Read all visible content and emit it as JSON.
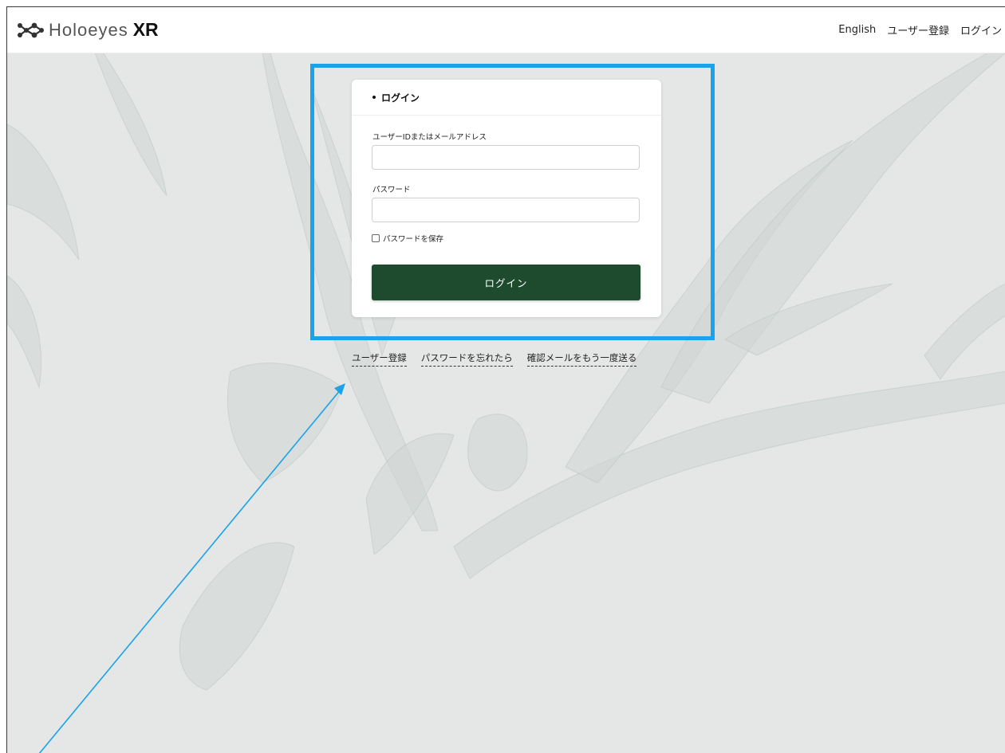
{
  "header": {
    "logo_text": "Holoeyes",
    "logo_suffix": "XR",
    "nav": [
      "English",
      "ユーザー登録",
      "ログイン"
    ]
  },
  "login_card": {
    "title": "ログイン",
    "user_label": "ユーザーIDまたはメールアドレス",
    "user_value": "",
    "password_label": "パスワード",
    "password_value": "",
    "remember_label": "パスワードを保存",
    "remember_checked": false,
    "submit_label": "ログイン"
  },
  "links": [
    "ユーザー登録",
    "パスワードを忘れたら",
    "確認メールをもう一度送る"
  ],
  "colors": {
    "primary_button": "#1e4a2e",
    "highlight_box": "#1aa3e8",
    "background": "#e4e7e6"
  },
  "icons": [
    "holoeyes-logo-icon",
    "checkbox-icon",
    "callout-arrow-icon"
  ]
}
